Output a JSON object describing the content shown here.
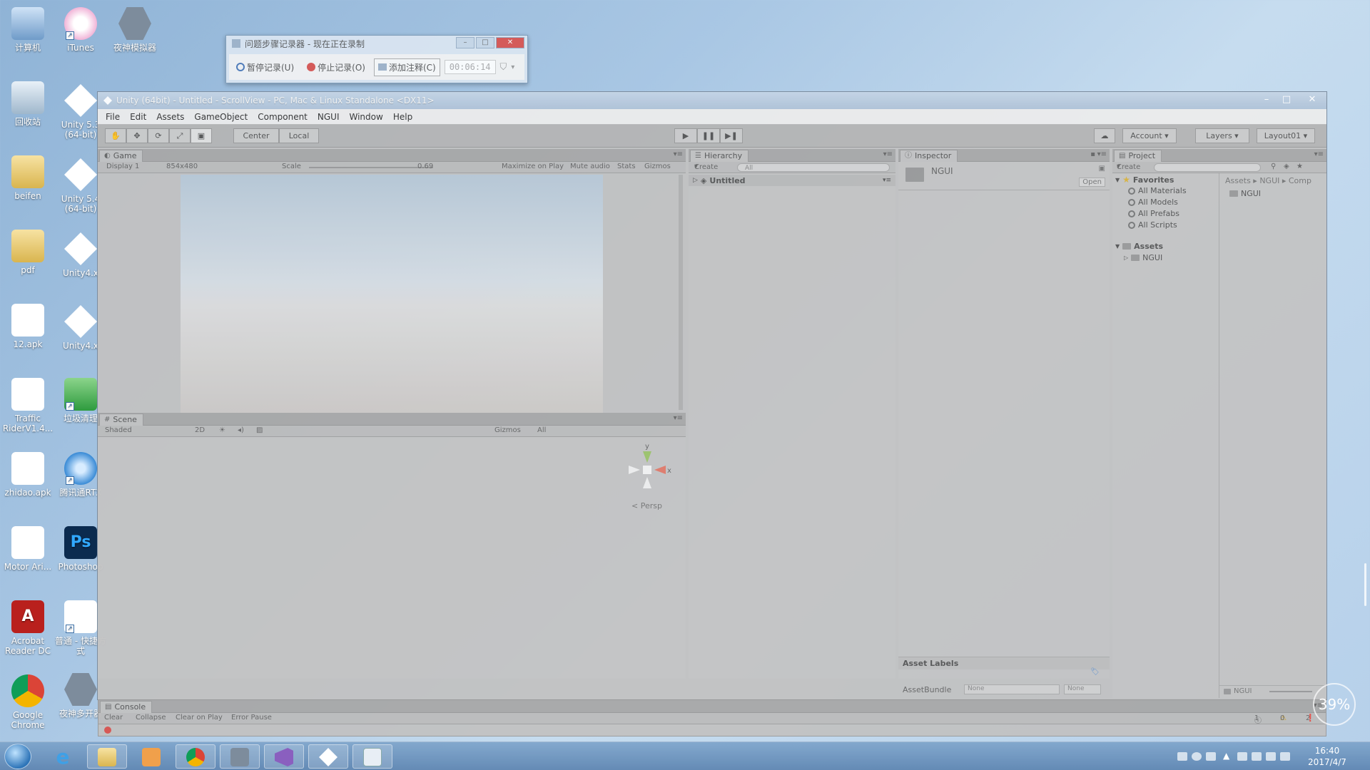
{
  "desktop": {
    "icons": [
      {
        "label": "计算机",
        "icon": "computer-icon"
      },
      {
        "label": "iTunes",
        "icon": "itunes-icon"
      },
      {
        "label": "夜神模拟器",
        "icon": "nox-icon"
      },
      {
        "label": "回收站",
        "icon": "recycle-bin-icon"
      },
      {
        "label": "Unity 5.3 (64-bit)",
        "icon": "unity-icon"
      },
      {
        "label": "beifen",
        "icon": "folder-icon"
      },
      {
        "label": "Unity 5.4 (64-bit)",
        "icon": "unity-icon"
      },
      {
        "label": "pdf",
        "icon": "folder-icon"
      },
      {
        "label": "Unity4.x",
        "icon": "unity-icon"
      },
      {
        "label": "12.apk",
        "icon": "file-icon"
      },
      {
        "label": "Unity4.x",
        "icon": "unity-icon"
      },
      {
        "label": "Traffic RiderV1.4...",
        "icon": "file-icon"
      },
      {
        "label": "垃圾清理",
        "icon": "cleaner-icon"
      },
      {
        "label": "zhidao.apk",
        "icon": "file-icon"
      },
      {
        "label": "腾讯通RTX",
        "icon": "rtx-icon"
      },
      {
        "label": "Motor Ari...",
        "icon": "doc-icon"
      },
      {
        "label": "Photoshop",
        "icon": "photoshop-icon"
      },
      {
        "label": "Acrobat Reader DC",
        "icon": "acrobat-icon"
      },
      {
        "label": "普通 - 快捷方式",
        "icon": "shortcut-icon"
      },
      {
        "label": "Google Chrome",
        "icon": "chrome-icon"
      },
      {
        "label": "夜神多开器",
        "icon": "nox-icon"
      }
    ]
  },
  "recorder": {
    "title": "问题步骤记录器 - 现在正在录制",
    "pause": "暂停记录(U)",
    "stop": "停止记录(O)",
    "comment": "添加注释(C)",
    "time": "00:06:14",
    "colors": {
      "stop": "#d9534f",
      "pause": "#4a78b8"
    }
  },
  "unity": {
    "title": "Unity (64bit) - Untitled - ScrollView - PC, Mac & Linux Standalone <DX11>",
    "menu": [
      "File",
      "Edit",
      "Assets",
      "GameObject",
      "Component",
      "NGUI",
      "Window",
      "Help"
    ],
    "toolbar": {
      "center": "Center",
      "local": "Local",
      "account": "Account",
      "layers": "Layers",
      "layout": "Layout01"
    },
    "game": {
      "tab": "Game",
      "display": "Display 1",
      "resolution": "854x480",
      "scale_label": "Scale",
      "scale_value": "0.69",
      "maximize": "Maximize on Play",
      "mute": "Mute audio",
      "stats": "Stats",
      "gizmos": "Gizmos"
    },
    "scene": {
      "tab": "Scene",
      "shaded": "Shaded",
      "mode2d": "2D",
      "gizmos": "Gizmos",
      "search": "All",
      "persp": "Persp",
      "axis_x": "x",
      "axis_y": "y"
    },
    "hierarchy": {
      "tab": "Hierarchy",
      "create": "Create",
      "search": "All",
      "root": "Untitled"
    },
    "inspector": {
      "tab": "Inspector",
      "asset_name": "NGUI",
      "open": "Open",
      "asset_labels": "Asset Labels",
      "assetbundle_label": "AssetBundle",
      "assetbundle_value": "None",
      "assetbundle_variant": "None"
    },
    "project": {
      "tab": "Project",
      "create": "Create",
      "favorites": "Favorites",
      "fav_items": [
        "All Materials",
        "All Models",
        "All Prefabs",
        "All Scripts"
      ],
      "assets": "Assets",
      "assets_child": "NGUI",
      "breadcrumb": "Assets ▸ NGUI ▸ Comp",
      "content_item": "NGUI",
      "footer": "NGUI"
    },
    "console": {
      "tab": "Console",
      "clear": "Clear",
      "collapse": "Collapse",
      "clear_on_play": "Clear on Play",
      "error_pause": "Error Pause",
      "info_count": "1",
      "warn_count": "0",
      "error_count": "2"
    }
  },
  "taskbar": {
    "time": "16:40",
    "date": "2017/4/7"
  },
  "overlay": {
    "percent": "39%"
  }
}
